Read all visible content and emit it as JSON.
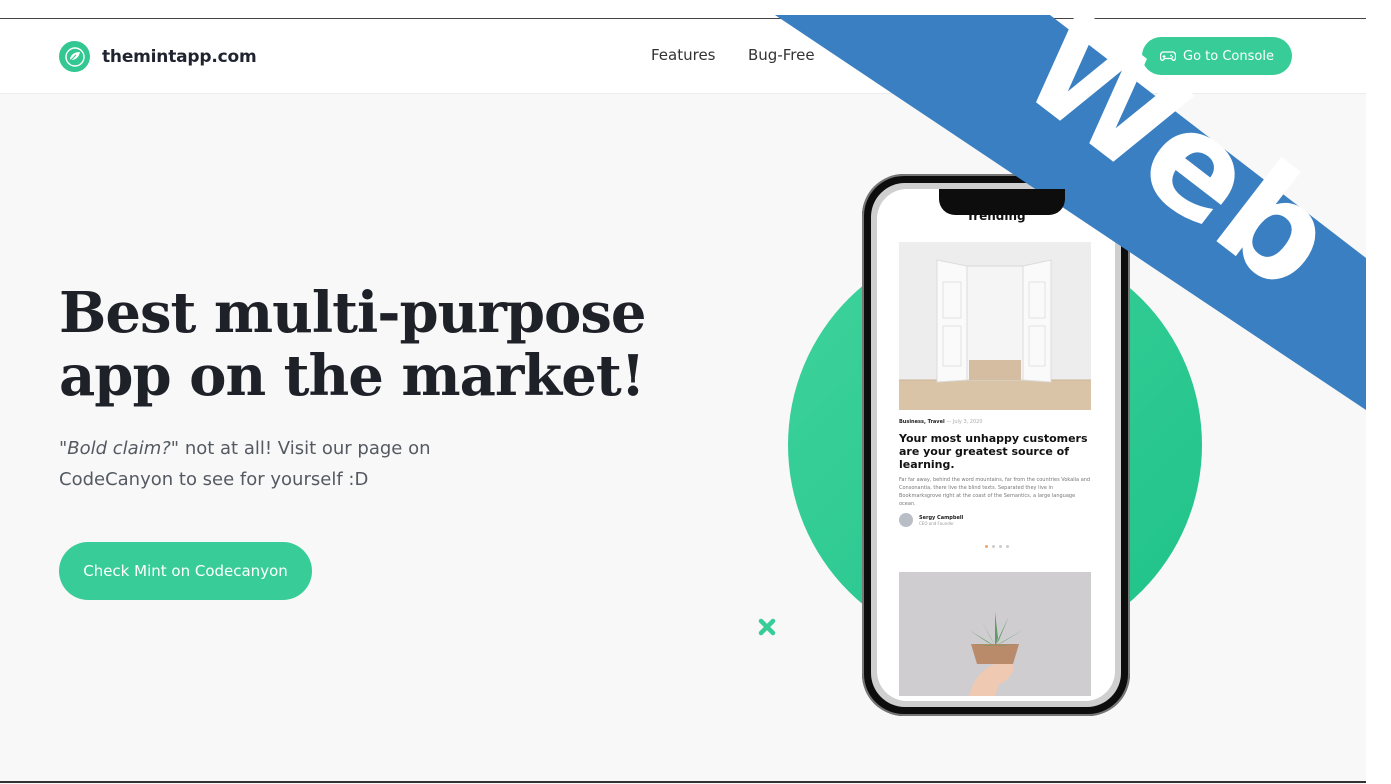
{
  "nav": {
    "brand": "themintapp.com",
    "links": [
      "Features",
      "Bug-Free"
    ],
    "console_button": "Go to Console"
  },
  "hero": {
    "title_line1": "Best multi-purpose",
    "title_line2": "app on the market!",
    "subtitle_italic": "\"Bold claim?\"",
    "subtitle_rest": " not at all! Visit our page on CodeCanyon to see for yourself :D",
    "cta": "Check Mint on Codecanyon"
  },
  "phone": {
    "section_title": "Trending",
    "card": {
      "category": "Business, Travel",
      "date": "July 3, 2020",
      "title": "Your most unhappy customers are your greatest source of learning.",
      "excerpt": "Far far away, behind the word mountains, far from the countries Vokalia and Consonantia, there live the blind texts. Separated they live in Bookmarksgrove right at the coast of the Semantics, a large language ocean.",
      "author_name": "Sergy Campbell",
      "author_role": "CEO and Founder"
    }
  },
  "ribbon": {
    "label": "Web"
  },
  "colors": {
    "accent": "#38cd98",
    "ribbon": "#3a7fc1",
    "text_dark": "#1e2127"
  }
}
